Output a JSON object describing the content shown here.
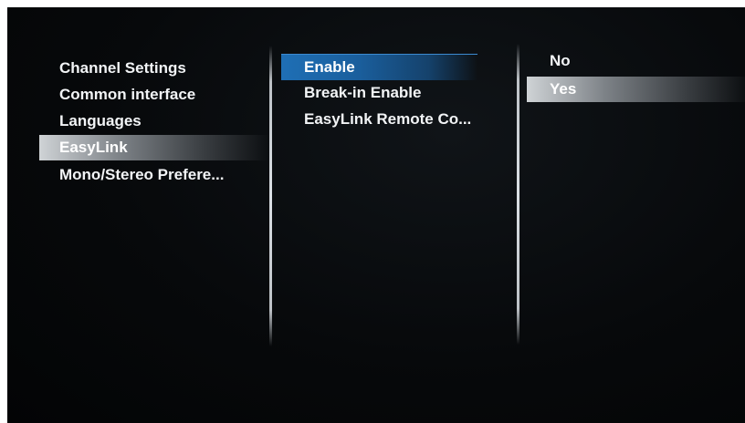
{
  "left_menu": {
    "items": [
      {
        "label": "Channel Settings"
      },
      {
        "label": "Common interface"
      },
      {
        "label": "Languages"
      },
      {
        "label": "EasyLink"
      },
      {
        "label": "Mono/Stereo Prefere..."
      }
    ],
    "selected_index": 3
  },
  "middle_menu": {
    "items": [
      {
        "label": "Enable"
      },
      {
        "label": "Break-in Enable"
      },
      {
        "label": "EasyLink Remote Co..."
      }
    ],
    "focused_index": 0
  },
  "right_menu": {
    "items": [
      {
        "label": "No"
      },
      {
        "label": "Yes"
      }
    ],
    "selected_index": 1
  },
  "colors": {
    "background": "#05070a",
    "text": "#f2f4f6",
    "focus_blue": "#1f6fb5",
    "selection_gray": "#8a8f94"
  }
}
